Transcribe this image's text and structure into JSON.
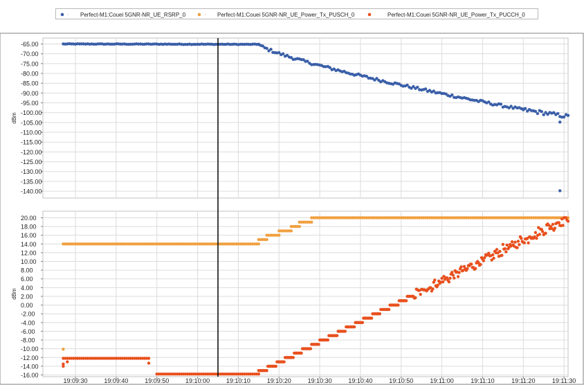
{
  "chart_data": {
    "type": "scatter",
    "colors": {
      "rsrp": "#3a5fa8",
      "pusch": "#f0a040",
      "pucch": "#e8501e",
      "grid": "#dcdcdc",
      "cursor": "#000000",
      "axis": "#808080"
    },
    "legend": {
      "placement": "top",
      "entries": [
        {
          "key": "rsrp",
          "marker_glyph": "‧",
          "label": "Perfect-M1:Couei 5GNR-NR_UE_RSRP_0"
        },
        {
          "key": "pusch",
          "marker_glyph": "‧",
          "label": "Perfect-M1:Couei 5GNR-NR_UE_Power_Tx_PUSCH_0"
        },
        {
          "key": "pucch",
          "marker_glyph": "",
          "label": "Perfect-M1:Couei 5GNR-NR_UE_Power_Tx_PUCCH_0"
        }
      ]
    },
    "x_axis": {
      "start": "19:09:22",
      "end": "19:11:31",
      "ticks": [
        "19:09:30",
        "19:09:40",
        "19:09:50",
        "19:10:00",
        "19:10:10",
        "19:10:20",
        "19:10:30",
        "19:10:40",
        "19:10:50",
        "19:11:00",
        "19:11:10",
        "19:11:20",
        "19:11:30"
      ]
    },
    "cursor_time": "19:10:05",
    "panels": [
      {
        "id": "rsrp_panel",
        "ylabel": "dBm",
        "ylim": [
          -143.5,
          -62
        ],
        "yticks": [
          "-65.00",
          "-70.00",
          "-75.00",
          "-80.00",
          "-85.00",
          "-90.00",
          "-95.00",
          "-100.00",
          "-105.00",
          "-110.00",
          "-115.00",
          "-120.00",
          "-125.00",
          "-130.00",
          "-135.00",
          "-140.00"
        ],
        "ytick_values": [
          -65,
          -70,
          -75,
          -80,
          -85,
          -90,
          -95,
          -100,
          -105,
          -110,
          -115,
          -120,
          -125,
          -130,
          -135,
          -140
        ],
        "series": [
          {
            "key": "rsrp",
            "name": "Perfect-M1:Couei 5GNR-NR_UE_RSRP_0",
            "segments": [
              {
                "t0": "19:09:27",
                "t1": "19:10:15",
                "v0": -65.0,
                "v1": -65.2,
                "noise": 0.15
              },
              {
                "t0": "19:10:15",
                "t1": "19:11:20",
                "v0": -65.2,
                "v1": -98.5,
                "noise": 0.7,
                "curve": 1.3
              },
              {
                "t0": "19:11:20",
                "t1": "19:11:31",
                "v0": -98.5,
                "v1": -102.0,
                "noise": 1.0
              }
            ],
            "outliers": [
              {
                "t": "19:11:29",
                "v": -104.8
              },
              {
                "t": "19:11:29",
                "v": -139.8
              }
            ]
          }
        ]
      },
      {
        "id": "power_panel",
        "ylabel": "dBm",
        "ylim": [
          -16.4,
          21.5
        ],
        "yticks": [
          "20.00",
          "18.00",
          "16.00",
          "14.00",
          "12.00",
          "10.00",
          "8.00",
          "6.00",
          "4.00",
          "2.00",
          "0.00",
          "-2.00",
          "-4.00",
          "-6.00",
          "-8.00",
          "-10.00",
          "-12.00",
          "-14.00",
          "-16.00"
        ],
        "ytick_values": [
          20,
          18,
          16,
          14,
          12,
          10,
          8,
          6,
          4,
          2,
          0,
          -2,
          -4,
          -6,
          -8,
          -10,
          -12,
          -14,
          -16
        ],
        "series": [
          {
            "key": "pusch",
            "name": "Perfect-M1:Couei 5GNR-NR_UE_Power_Tx_PUSCH_0",
            "steps": [
              {
                "t0": "19:09:27",
                "t1": "19:10:15",
                "v": 14
              },
              {
                "t0": "19:10:15",
                "t1": "19:10:17",
                "v": 15
              },
              {
                "t0": "19:10:17",
                "t1": "19:10:20",
                "v": 16
              },
              {
                "t0": "19:10:20",
                "t1": "19:10:23",
                "v": 17
              },
              {
                "t0": "19:10:23",
                "t1": "19:10:25",
                "v": 18
              },
              {
                "t0": "19:10:25",
                "t1": "19:10:28",
                "v": 19
              },
              {
                "t0": "19:10:28",
                "t1": "19:11:31",
                "v": 20
              }
            ],
            "outliers": [
              {
                "t": "19:09:27",
                "v": -10.1
              }
            ]
          },
          {
            "key": "pucch",
            "name": "Perfect-M1:Couei 5GNR-NR_UE_Power_Tx_PUCCH_0",
            "steps": [
              {
                "t0": "19:09:27",
                "t1": "19:09:48",
                "v": -12.2
              },
              {
                "t0": "19:09:50",
                "t1": "19:10:15",
                "v": -15.8
              }
            ],
            "ramp": {
              "t0": "19:10:15",
              "t1": "19:11:31",
              "v0": -15.5,
              "v1": 20,
              "noise": 0.9
            },
            "outliers": [
              {
                "t": "19:09:27",
                "v": -13.5
              },
              {
                "t": "19:09:27",
                "v": -14.0
              },
              {
                "t": "19:09:28",
                "v": -13.0
              },
              {
                "t": "19:09:48",
                "v": -13.3
              }
            ]
          }
        ]
      }
    ]
  }
}
